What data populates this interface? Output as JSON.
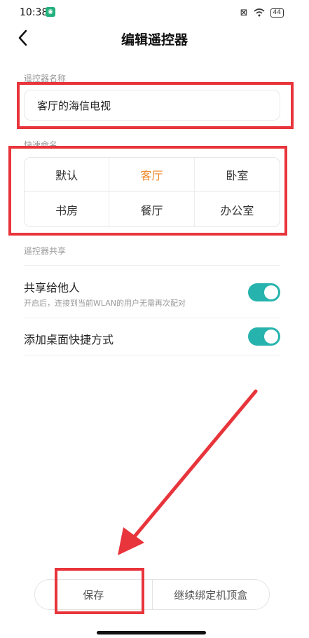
{
  "status_bar": {
    "time": "10:38",
    "battery": "44"
  },
  "header": {
    "title": "编辑遥控器"
  },
  "name_section": {
    "label": "遥控器名称",
    "value": "客厅的海信电视"
  },
  "quick_section": {
    "label": "快速命名",
    "options": [
      {
        "label": "默认",
        "selected": false
      },
      {
        "label": "客厅",
        "selected": true
      },
      {
        "label": "卧室",
        "selected": false
      },
      {
        "label": "书房",
        "selected": false
      },
      {
        "label": "餐厅",
        "selected": false
      },
      {
        "label": "办公室",
        "selected": false
      }
    ]
  },
  "share_section": {
    "label": "遥控器共享",
    "share_title": "共享给他人",
    "share_desc": "开启后，连接到当前WLAN的用户无需再次配对",
    "share_enabled": true,
    "shortcut_title": "添加桌面快捷方式",
    "shortcut_enabled": true
  },
  "buttons": {
    "save": "保存",
    "continue": "继续绑定机顶盒"
  },
  "colors": {
    "accent_orange": "#f08a2c",
    "toggle_on": "#27b3ad",
    "highlight_red": "#e8343b"
  }
}
